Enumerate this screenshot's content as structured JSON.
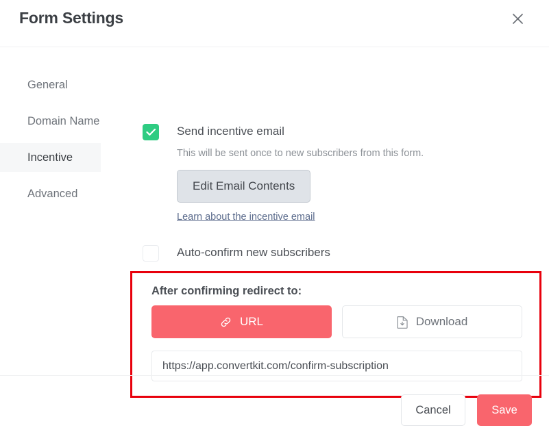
{
  "header": {
    "title": "Form Settings",
    "close_icon": "close-icon"
  },
  "sidebar": {
    "items": [
      {
        "label": "General",
        "active": false
      },
      {
        "label": "Domain Name",
        "active": false
      },
      {
        "label": "Incentive",
        "active": true
      },
      {
        "label": "Advanced",
        "active": false
      }
    ]
  },
  "incentive": {
    "send_email": {
      "label": "Send incentive email",
      "checked": true,
      "help_text": "This will be sent once to new subscribers from this form.",
      "edit_button": "Edit Email Contents",
      "learn_link": "Learn about the incentive email"
    },
    "auto_confirm": {
      "label": "Auto-confirm new subscribers",
      "checked": false
    },
    "redirect": {
      "label": "After confirming redirect to:",
      "options": [
        {
          "label": "URL",
          "icon": "link-icon",
          "active": true
        },
        {
          "label": "Download",
          "icon": "file-download-icon",
          "active": false
        }
      ],
      "url_value": "https://app.convertkit.com/confirm-subscription",
      "url_placeholder": "https://"
    }
  },
  "footer": {
    "cancel_label": "Cancel",
    "save_label": "Save"
  },
  "colors": {
    "accent_red": "#f9656d",
    "checkbox_green": "#2ecc82",
    "highlight_border": "#e8000c",
    "link_blue": "#5b6b8c"
  }
}
